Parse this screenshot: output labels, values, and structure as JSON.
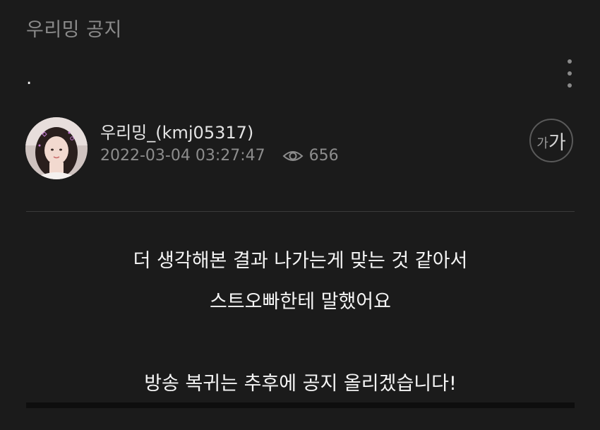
{
  "board": {
    "title": "우리밍 공지"
  },
  "post": {
    "title": ".",
    "author": "우리밍_(kmj05317)",
    "datetime": "2022-03-04 03:27:47",
    "views": "656",
    "content": {
      "line1": "더 생각해본 결과 나가는게 맞는 것 같아서",
      "line2": "스트오빠한테 말했어요",
      "line3": "",
      "line4": "방송 복귀는 추후에 공지 올리겠습니다!"
    }
  },
  "font_size_button": {
    "small": "가",
    "large": "가"
  },
  "icons": {
    "more": "more-vertical-icon",
    "views": "eye-icon"
  },
  "colors": {
    "background": "#1b1b1b",
    "muted_text": "#8a8a8a",
    "body_text": "#f5f5f5",
    "divider": "#3a3a3a"
  }
}
